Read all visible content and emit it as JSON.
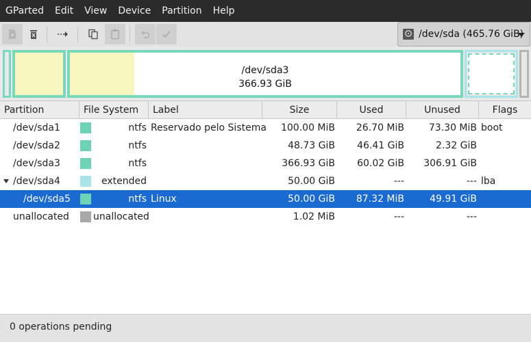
{
  "menu": [
    "GParted",
    "Edit",
    "View",
    "Device",
    "Partition",
    "Help"
  ],
  "device_selector": {
    "label": "/dev/sda (465.76 GiB)"
  },
  "diskmap": {
    "sda3_name": "/dev/sda3",
    "sda3_size": "366.93 GiB"
  },
  "table": {
    "headers": [
      "Partition",
      "File System",
      "Label",
      "Size",
      "Used",
      "Unused",
      "Flags"
    ],
    "rows": [
      {
        "partition": "/dev/sda1",
        "fs": "ntfs",
        "fs_color": "#6ed3b5",
        "label": "Reservado pelo Sistema",
        "size": "100.00 MiB",
        "used": "26.70 MiB",
        "unused": "73.30 MiB",
        "flags": "boot"
      },
      {
        "partition": "/dev/sda2",
        "fs": "ntfs",
        "fs_color": "#6ed3b5",
        "label": "",
        "size": "48.73 GiB",
        "used": "46.41 GiB",
        "unused": "2.32 GiB",
        "flags": ""
      },
      {
        "partition": "/dev/sda3",
        "fs": "ntfs",
        "fs_color": "#6ed3b5",
        "label": "",
        "size": "366.93 GiB",
        "used": "60.02 GiB",
        "unused": "306.91 GiB",
        "flags": ""
      },
      {
        "partition": "/dev/sda4",
        "fs": "extended",
        "fs_color": "#a8e4e8",
        "label": "",
        "size": "50.00 GiB",
        "used": "---",
        "unused": "---",
        "flags": "lba"
      },
      {
        "partition": "/dev/sda5",
        "fs": "ntfs",
        "fs_color": "#6ed3b5",
        "label": "Linux",
        "size": "50.00 GiB",
        "used": "87.32 MiB",
        "unused": "49.91 GiB",
        "flags": ""
      },
      {
        "partition": "unallocated",
        "fs": "unallocated",
        "fs_color": "#a8a8a8",
        "label": "",
        "size": "1.02 MiB",
        "used": "---",
        "unused": "---",
        "flags": ""
      }
    ]
  },
  "status": {
    "text": "0 operations pending"
  },
  "icons": {
    "new": "new-partition-icon",
    "delete": "delete-icon",
    "resize": "resize-move-icon",
    "copy": "copy-icon",
    "paste": "paste-icon",
    "undo": "undo-icon",
    "apply": "apply-icon",
    "disk": "disk-icon"
  }
}
